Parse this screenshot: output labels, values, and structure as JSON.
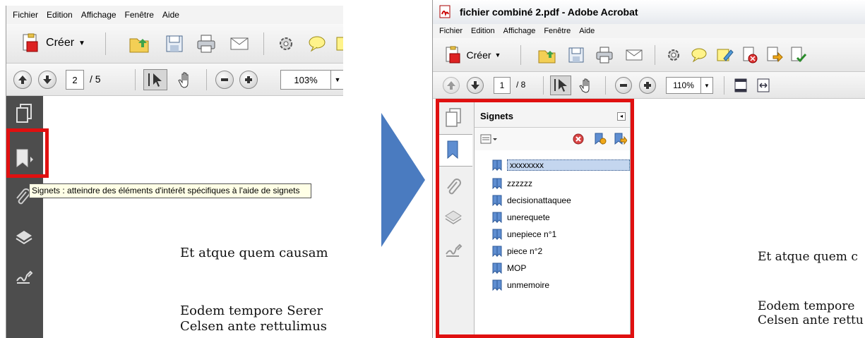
{
  "left": {
    "menu": [
      "Fichier",
      "Edition",
      "Affichage",
      "Fenêtre",
      "Aide"
    ],
    "toolbar": {
      "create_label": "Créer"
    },
    "nav": {
      "page_current": "2",
      "page_total": "/ 5",
      "zoom": "103%"
    },
    "tooltip": "Signets : atteindre des éléments d'intérêt spécifiques à l'aide de signets",
    "doc_lines": [
      "Et atque quem causam",
      "Eodem tempore Serer",
      "Celsen ante rettulimus"
    ]
  },
  "right": {
    "title": "fichier combiné 2.pdf - Adobe Acrobat",
    "menu": [
      "Fichier",
      "Edition",
      "Affichage",
      "Fenêtre",
      "Aide"
    ],
    "toolbar": {
      "create_label": "Créer"
    },
    "nav": {
      "page_current": "1",
      "page_total": "/ 8",
      "zoom": "110%"
    },
    "bookmarks_panel": {
      "title": "Signets",
      "items": [
        "xxxxxxxx",
        "zzzzzz",
        "decisionattaquee",
        "unerequete",
        "unepiece n°1",
        "piece n°2",
        "MOP",
        "unmemoire"
      ]
    },
    "doc_lines": [
      "Et atque quem c",
      "Eodem tempore",
      "Celsen ante rettu"
    ]
  },
  "colors": {
    "highlight_box": "#e01010",
    "arrow": "#4a7bc0",
    "selected_bg": "#c4d6ef"
  }
}
